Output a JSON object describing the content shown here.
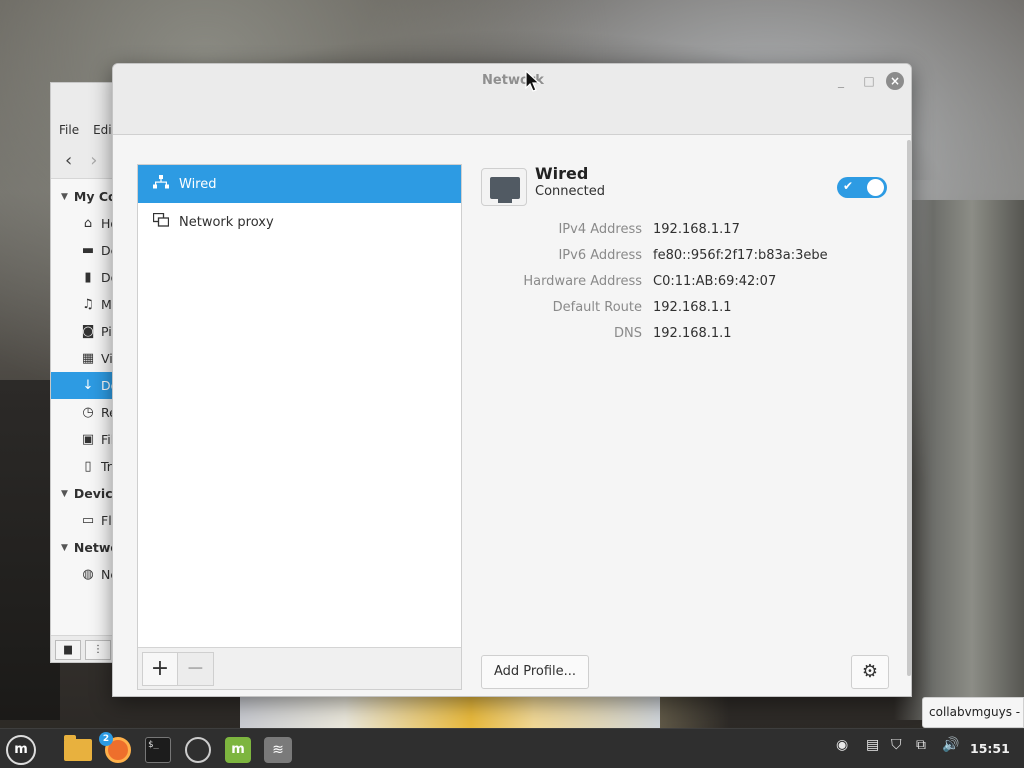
{
  "file_manager": {
    "menu": [
      "File",
      "Edi"
    ],
    "sections": [
      {
        "title": "My Co",
        "items": [
          {
            "icon": "home-icon",
            "glyph": "⌂",
            "label": "Ho"
          },
          {
            "icon": "desktop-icon",
            "glyph": "▬",
            "label": "De"
          },
          {
            "icon": "document-icon",
            "glyph": "▮",
            "label": "Do"
          },
          {
            "icon": "music-icon",
            "glyph": "♫",
            "label": "M"
          },
          {
            "icon": "camera-icon",
            "glyph": "◙",
            "label": "Pi"
          },
          {
            "icon": "film-icon",
            "glyph": "▦",
            "label": "Vi"
          },
          {
            "icon": "download-icon",
            "glyph": "↓",
            "label": "Do",
            "selected": true
          },
          {
            "icon": "clock-icon",
            "glyph": "◷",
            "label": "Re"
          },
          {
            "icon": "filesystem-icon",
            "glyph": "▣",
            "label": "Fil"
          },
          {
            "icon": "trash-icon",
            "glyph": "▯",
            "label": "Tr"
          }
        ]
      },
      {
        "title": "Devic",
        "items": [
          {
            "icon": "floppy-icon",
            "glyph": "▭",
            "label": "Fl"
          }
        ]
      },
      {
        "title": "Netwo",
        "items": [
          {
            "icon": "globe-icon",
            "glyph": "◍",
            "label": "Ne"
          }
        ]
      }
    ]
  },
  "network_window": {
    "title": "Network",
    "connections": [
      {
        "label": "Wired",
        "icon": "wired-network-icon",
        "selected": true
      },
      {
        "label": "Network proxy",
        "icon": "network-proxy-icon",
        "selected": false
      }
    ],
    "add_symbol": "+",
    "remove_symbol": "−",
    "device": {
      "name": "Wired",
      "status": "Connected",
      "enabled": true
    },
    "details": [
      {
        "label": "IPv4 Address",
        "value": "192.168.1.17"
      },
      {
        "label": "IPv6 Address",
        "value": "fe80::956f:2f17:b83a:3ebe"
      },
      {
        "label": "Hardware Address",
        "value": "C0:11:AB:69:42:07"
      },
      {
        "label": "Default Route",
        "value": "192.168.1.1"
      },
      {
        "label": "DNS",
        "value": "192.168.1.1"
      }
    ],
    "add_profile_label": "Add Profile..."
  },
  "tooltip": "collabvmguys -",
  "taskbar": {
    "firefox_badge": "2",
    "terminal_text": "$_",
    "mint_menu_glyph": "m",
    "mint_update_glyph": "m",
    "clock": "15:51"
  },
  "colors": {
    "accent": "#2d9be3",
    "taskbar": "#2f2f2f"
  }
}
